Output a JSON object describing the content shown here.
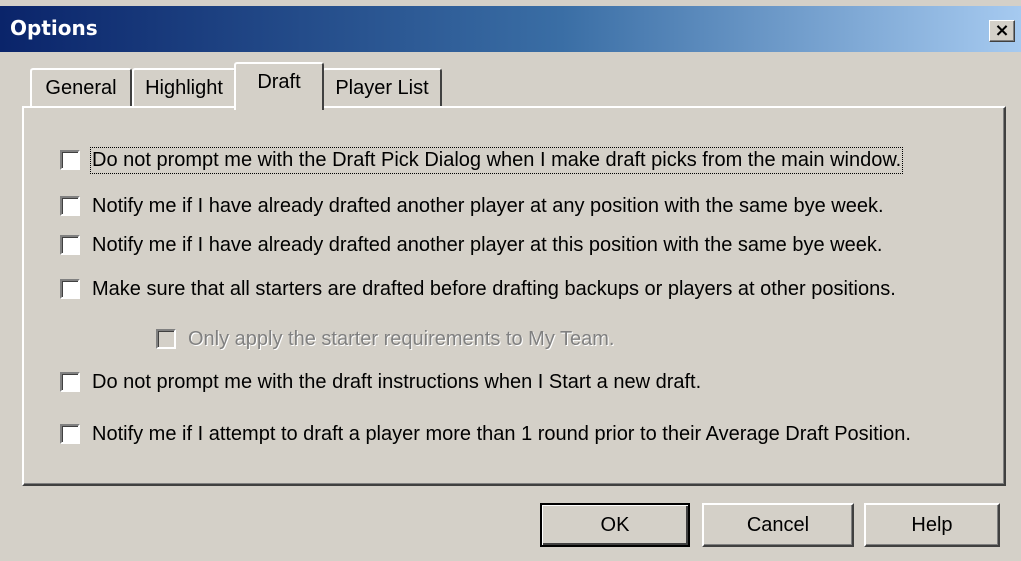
{
  "window": {
    "title": "Options",
    "close_glyph": "×"
  },
  "tabs": [
    {
      "label": "General",
      "active": false
    },
    {
      "label": "Highlight",
      "active": false
    },
    {
      "label": "Draft",
      "active": true
    },
    {
      "label": "Player List",
      "active": false
    }
  ],
  "options": [
    {
      "label": "Do not prompt me with the Draft Pick Dialog when I make draft picks from the main window.",
      "checked": false,
      "enabled": true,
      "focused": true
    },
    {
      "label": "Notify me if I have already drafted another player at any position with the same bye week.",
      "checked": false,
      "enabled": true
    },
    {
      "label": "Notify me if I have already drafted another player at this position with the same bye week.",
      "checked": false,
      "enabled": true
    },
    {
      "label": "Make sure that all starters are drafted before drafting backups or players at other positions.",
      "checked": false,
      "enabled": true
    },
    {
      "label": "Only apply the starter requirements to My Team.",
      "checked": false,
      "enabled": false
    },
    {
      "label": "Do not prompt me with the draft instructions when I Start a new draft.",
      "checked": false,
      "enabled": true
    },
    {
      "label": "Notify me if I attempt to draft a player more than 1 round prior to their Average Draft Position.",
      "checked": false,
      "enabled": true
    }
  ],
  "buttons": {
    "ok": "OK",
    "cancel": "Cancel",
    "help": "Help"
  }
}
